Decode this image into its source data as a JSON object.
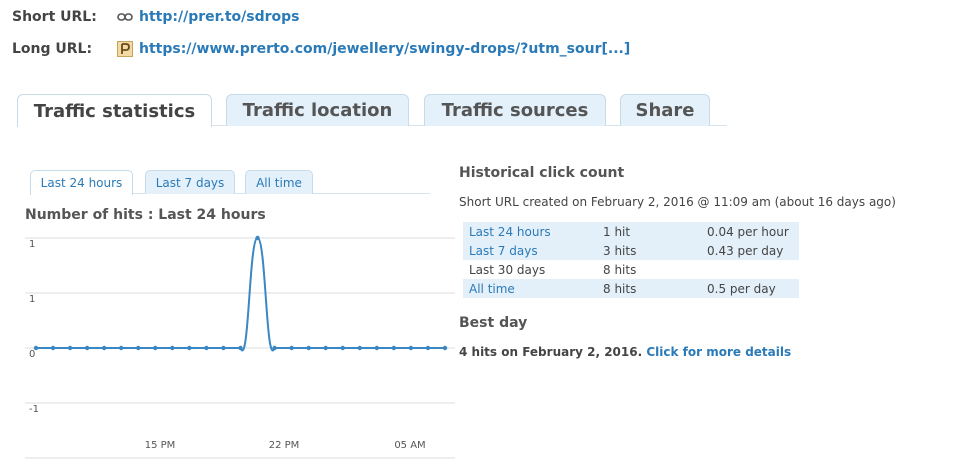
{
  "short_url": {
    "label": "Short URL:",
    "value": "http://prer.to/sdrops",
    "icon": "link-icon"
  },
  "long_url": {
    "label": "Long URL:",
    "value": "https://www.prerto.com/jewellery/swingy-drops/?utm_sour[...]",
    "icon": "site-favicon"
  },
  "tabs": [
    {
      "label": "Traffic statistics",
      "active": true
    },
    {
      "label": "Traffic location"
    },
    {
      "label": "Traffic sources"
    },
    {
      "label": "Share"
    }
  ],
  "subtabs": [
    {
      "label": "Last 24 hours",
      "active": true
    },
    {
      "label": "Last 7 days"
    },
    {
      "label": "All time"
    }
  ],
  "chart_title": "Number of hits : Last 24 hours",
  "chart_data": {
    "type": "line",
    "title": "Number of hits : Last 24 hours",
    "ytick_labels": [
      "1",
      "1",
      "0",
      "-1"
    ],
    "xtick_labels": [
      "15 PM",
      "22 PM",
      "05 AM"
    ],
    "x": [
      1,
      2,
      3,
      4,
      5,
      6,
      7,
      8,
      9,
      10,
      11,
      12,
      13,
      14,
      15,
      16,
      17,
      18,
      19,
      20,
      21,
      22,
      23,
      24,
      25
    ],
    "y": [
      0,
      0,
      0,
      0,
      0,
      0,
      0,
      0,
      0,
      0,
      0,
      0,
      0,
      1,
      0,
      0,
      0,
      0,
      0,
      0,
      0,
      0,
      0,
      0,
      0
    ],
    "ylim": [
      -1,
      1
    ],
    "series_color": "#3a87c4",
    "grid": true
  },
  "historical": {
    "title": "Historical click count",
    "created": "Short URL created on February 2, 2016 @ 11:09 am (about 16 days ago)",
    "rows": [
      {
        "period": "Last 24 hours",
        "hits": "1 hit",
        "rate": "0.04 per hour"
      },
      {
        "period": "Last 7 days",
        "hits": "3 hits",
        "rate": "0.43 per day"
      },
      {
        "period": "Last 30 days",
        "hits": "8 hits",
        "rate": ""
      },
      {
        "period": "All time",
        "hits": "8 hits",
        "rate": "0.5 per day"
      }
    ]
  },
  "best_day": {
    "title": "Best day",
    "text": "4 hits on February 2, 2016.",
    "link": "Click for more details"
  }
}
